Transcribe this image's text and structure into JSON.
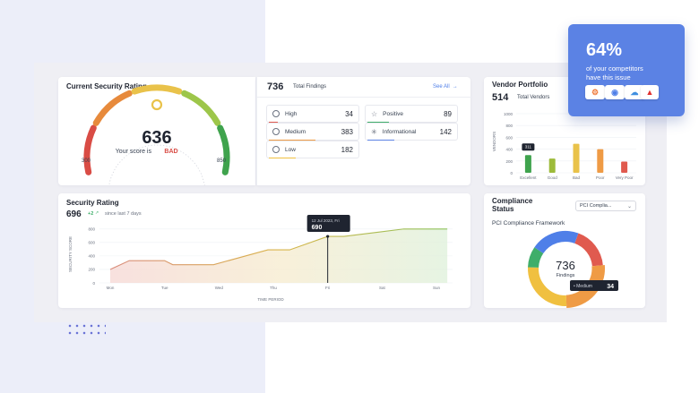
{
  "gauge": {
    "title": "Current Security Rating",
    "score": "636",
    "caption": "Your score is",
    "status": "BAD",
    "min": "300",
    "max": "850",
    "colors": [
      "#d94c45",
      "#e78a3c",
      "#e9c24a",
      "#9dc64a",
      "#3fa34d"
    ]
  },
  "findings": {
    "total": "736",
    "total_label": "Total Findings",
    "see_all": "See All",
    "items": [
      {
        "label": "High",
        "value": "34",
        "icon": "gauge-icon",
        "color": "#e05a4f"
      },
      {
        "label": "Positive",
        "value": "89",
        "icon": "star-icon",
        "color": "#3fae6a"
      },
      {
        "label": "Medium",
        "value": "383",
        "icon": "info-icon",
        "color": "#ef9b45"
      },
      {
        "label": "Informational",
        "value": "142",
        "icon": "sparkle-icon",
        "color": "#5b82e4"
      },
      {
        "label": "Low",
        "value": "182",
        "icon": "clock-icon",
        "color": "#f0c040"
      }
    ]
  },
  "vendor": {
    "title": "Vendor Portfolio",
    "total": "514",
    "total_label": "Total Vendors",
    "y_axis_label": "VENDORS",
    "tooltip": "311"
  },
  "chart_data": [
    {
      "type": "bar",
      "categories": [
        "Excellent",
        "Good",
        "Bad",
        "Poor",
        "Very Poor"
      ],
      "values": [
        300,
        240,
        490,
        400,
        190
      ],
      "colors": [
        "#3fa34d",
        "#9dbb3a",
        "#e9c24a",
        "#ef9b45",
        "#e05a4f"
      ],
      "ylabel": "VENDORS",
      "yticks": [
        "0",
        "200",
        "400",
        "600",
        "800",
        "1000"
      ],
      "ylim": [
        0,
        1000
      ]
    },
    {
      "type": "line",
      "title": "Security Rating",
      "ylabel": "SECURITY SCORE",
      "xlabel": "TIME PERIOD",
      "yticks": [
        "0",
        "200",
        "400",
        "600",
        "800"
      ],
      "ylim": [
        0,
        850
      ],
      "x_ticks": [
        "Mon",
        "Tue",
        "Wed",
        "Thu",
        "Fri",
        "Sat",
        "Sun"
      ],
      "x": [
        0,
        0.35,
        1,
        1.15,
        1.9,
        2.9,
        3.3,
        4,
        4.3,
        4.9,
        5.4,
        6.2
      ],
      "values": [
        200,
        330,
        330,
        270,
        270,
        490,
        490,
        690,
        690,
        750,
        800,
        800
      ]
    },
    {
      "type": "pie",
      "title": "PCI Compliance Framework",
      "categories": [
        "High",
        "Medium",
        "Low",
        "Positive",
        "Informational"
      ],
      "values": [
        18,
        26,
        26,
        9,
        21
      ],
      "colors": [
        "#e05a4f",
        "#ef9b45",
        "#f0c040",
        "#3fae6a",
        "#4f7fe8"
      ]
    }
  ],
  "rating": {
    "title": "Security Rating",
    "score": "696",
    "delta": "+2",
    "delta_label": "since last 7 days",
    "tooltip_date": "12 Jul 2023, Fri",
    "tooltip_value": "690"
  },
  "compliance": {
    "title": "Compliance Status",
    "select_value": "PCI Complia...",
    "framework": "PCI Compliance Framework",
    "total": "736",
    "total_label": "Findings",
    "tooltip_label": "Medium",
    "tooltip_value": "34"
  },
  "promo": {
    "percent": "64%",
    "line1": "of your competitors",
    "line2": "have this issue"
  }
}
